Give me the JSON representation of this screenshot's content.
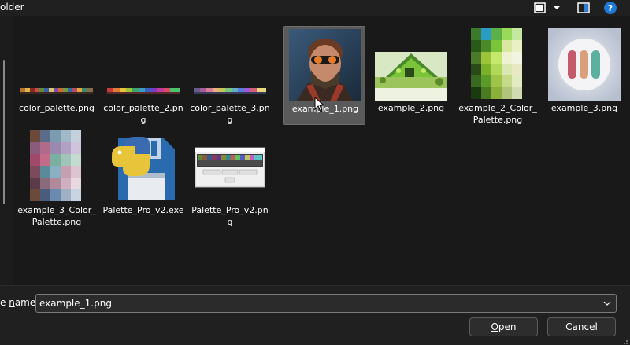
{
  "window": {
    "title": "older"
  },
  "toolbar": {
    "icons": [
      "view-icon",
      "chevron-down-icon",
      "preview-pane-icon",
      "help-icon"
    ],
    "help_glyph": "?"
  },
  "files": [
    {
      "name": "color_palette.png",
      "selected": false,
      "thumb": "palette-strip"
    },
    {
      "name": "color_palette_2.png",
      "selected": false,
      "thumb": "palette-strip"
    },
    {
      "name": "color_palette_3.png",
      "selected": false,
      "thumb": "palette-strip"
    },
    {
      "name": "example_1.png",
      "selected": true,
      "thumb": "portrait"
    },
    {
      "name": "example_2.png",
      "selected": false,
      "thumb": "landscape"
    },
    {
      "name": "example_2_Color_Palette.png",
      "selected": false,
      "thumb": "green-grid"
    },
    {
      "name": "example_3.png",
      "selected": false,
      "thumb": "pill-icon"
    },
    {
      "name": "example_3_Color_Palette.png",
      "selected": false,
      "thumb": "muted-grid"
    },
    {
      "name": "Palette_Pro_v2.exe",
      "selected": false,
      "thumb": "python-floppy"
    },
    {
      "name": "Palette_Pro_v2.png",
      "selected": false,
      "thumb": "app-screenshot"
    }
  ],
  "bottom": {
    "filename_label_prefix": "e ",
    "filename_label_underlined": "n",
    "filename_label_suffix": "ame:",
    "filename_value": "example_1.png",
    "open_prefix": "",
    "open_underlined": "O",
    "open_suffix": "pen",
    "cancel_label": "Cancel"
  },
  "colors": {
    "background": "#191919",
    "panel": "#202020",
    "selection": "#5a5a5a",
    "help_badge": "#1f7ad6"
  }
}
